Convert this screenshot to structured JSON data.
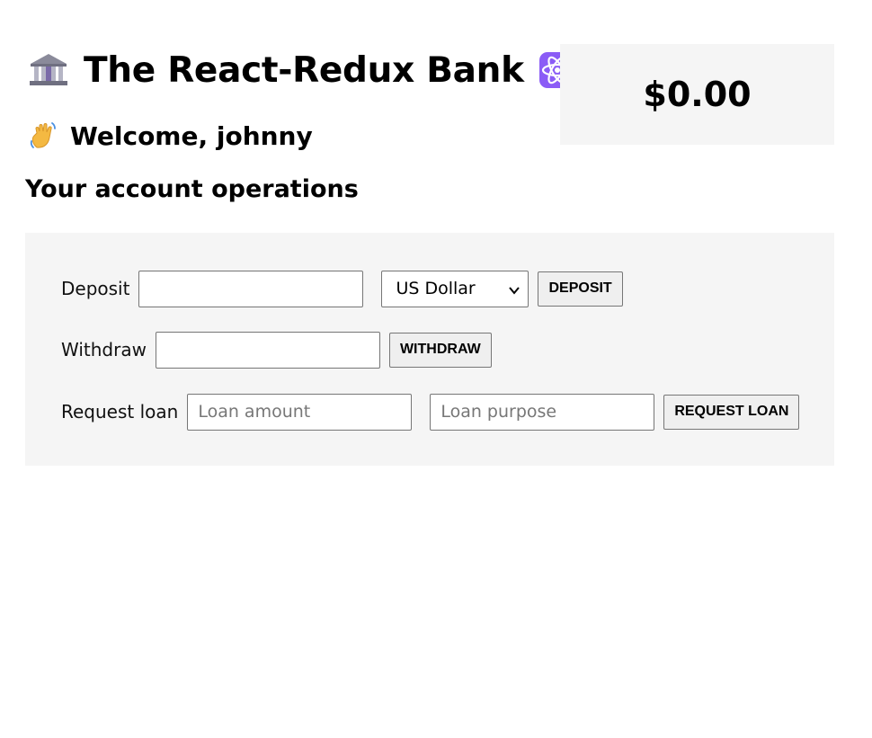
{
  "header": {
    "title": "The React-Redux Bank",
    "title_icon_left": "bank-icon",
    "title_icon_right": "atom-icon"
  },
  "welcome": {
    "text": "Welcome, johnny",
    "icon": "waving-hand-icon"
  },
  "balance": {
    "value": "$0.00"
  },
  "operations": {
    "heading": "Your account operations",
    "deposit": {
      "label": "Deposit",
      "value": "",
      "currency_selected": "US Dollar",
      "button_label": "DEPOSIT"
    },
    "withdraw": {
      "label": "Withdraw",
      "value": "",
      "button_label": "WITHDRAW"
    },
    "loan": {
      "label": "Request loan",
      "amount_placeholder": "Loan amount",
      "purpose_placeholder": "Loan purpose",
      "button_label": "REQUEST LOAN"
    }
  },
  "colors": {
    "panel_background": "#f5f5f5",
    "button_background": "#efefef",
    "input_border": "#767676",
    "atom_purple": "#8b5cf6"
  }
}
